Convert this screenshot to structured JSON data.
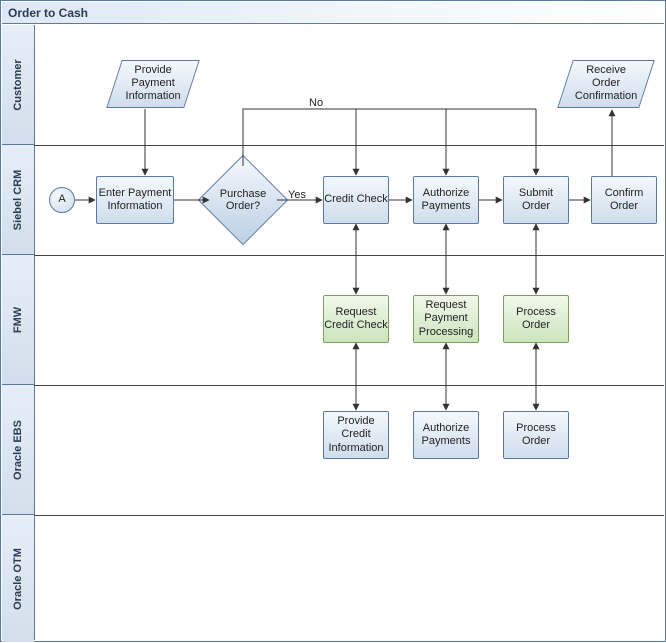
{
  "title": "Order to Cash",
  "lanes": {
    "customer": "Customer",
    "siebel": "Siebel CRM",
    "fmw": "FMW",
    "ebs": "Oracle EBS",
    "otm": "Oracle OTM"
  },
  "nodes": {
    "provide_payment_info": "Provide Payment Information",
    "receive_order_conf": "Receive Order Confirmation",
    "start": "A",
    "enter_payment_info": "Enter Payment Information",
    "purchase_order_q": "Purchase Order?",
    "credit_check": "Credit Check",
    "authorize_payments": "Authorize Payments",
    "submit_order": "Submit Order",
    "confirm_order": "Confirm Order",
    "request_credit_check": "Request Credit Check",
    "request_payment_processing": "Request Payment Processing",
    "process_order_fmw": "Process Order",
    "provide_credit_info": "Provide Credit Information",
    "authorize_payments_ebs": "Authorize Payments",
    "process_order_ebs": "Process Order"
  },
  "edges": {
    "yes": "Yes",
    "no": "No"
  }
}
